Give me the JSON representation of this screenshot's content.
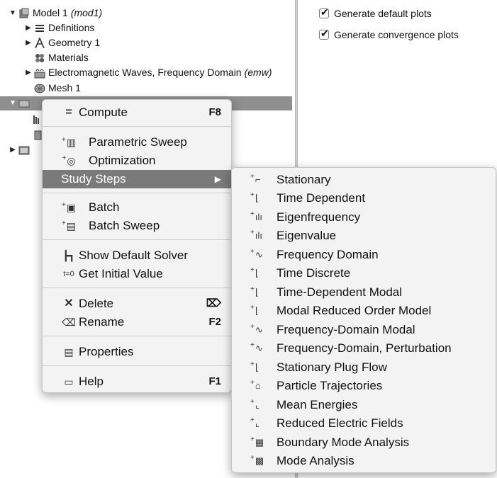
{
  "tree": {
    "rows": [
      {
        "label": "Model 1",
        "suffix": "(mod1)"
      },
      {
        "label": "Definitions",
        "suffix": ""
      },
      {
        "label": "Geometry 1",
        "suffix": ""
      },
      {
        "label": "Materials",
        "suffix": ""
      },
      {
        "label": "Electromagnetic Waves, Frequency Domain",
        "suffix": "(emw)"
      },
      {
        "label": "Mesh 1",
        "suffix": ""
      }
    ]
  },
  "settings": {
    "checkboxes": [
      {
        "label": "Generate default plots",
        "checked": true
      },
      {
        "label": "Generate convergence plots",
        "checked": true
      }
    ]
  },
  "context_menu": {
    "items": [
      {
        "label": "Compute",
        "shortcut": "F8",
        "icon": "compute-icon"
      },
      {
        "label": "Parametric Sweep",
        "shortcut": "",
        "icon": "parametric-sweep-icon"
      },
      {
        "label": "Optimization",
        "shortcut": "",
        "icon": "optimization-icon"
      },
      {
        "label": "Study Steps",
        "shortcut": "▶",
        "icon": ""
      },
      {
        "label": "Batch",
        "shortcut": "",
        "icon": "batch-icon"
      },
      {
        "label": "Batch Sweep",
        "shortcut": "",
        "icon": "batch-sweep-icon"
      },
      {
        "label": "Show Default Solver",
        "shortcut": "",
        "icon": "solver-icon"
      },
      {
        "label": "Get Initial Value",
        "shortcut": "",
        "icon": "initial-value-icon"
      },
      {
        "label": "Delete",
        "shortcut": "⌦",
        "icon": "delete-icon"
      },
      {
        "label": "Rename",
        "shortcut": "F2",
        "icon": "rename-icon"
      },
      {
        "label": "Properties",
        "shortcut": "",
        "icon": "properties-icon"
      },
      {
        "label": "Help",
        "shortcut": "F1",
        "icon": "help-icon"
      }
    ]
  },
  "submenu": {
    "items": [
      {
        "label": "Stationary",
        "icon": "stationary-icon"
      },
      {
        "label": "Time Dependent",
        "icon": "time-dependent-icon"
      },
      {
        "label": "Eigenfrequency",
        "icon": "eigenfrequency-icon"
      },
      {
        "label": "Eigenvalue",
        "icon": "eigenvalue-icon"
      },
      {
        "label": "Frequency Domain",
        "icon": "frequency-domain-icon"
      },
      {
        "label": "Time Discrete",
        "icon": "time-discrete-icon"
      },
      {
        "label": "Time-Dependent Modal",
        "icon": "time-dependent-modal-icon"
      },
      {
        "label": "Modal Reduced Order Model",
        "icon": "modal-reduced-order-icon"
      },
      {
        "label": "Frequency-Domain Modal",
        "icon": "frequency-domain-modal-icon"
      },
      {
        "label": "Frequency-Domain, Perturbation",
        "icon": "frequency-domain-perturbation-icon"
      },
      {
        "label": "Stationary Plug Flow",
        "icon": "plug-flow-icon"
      },
      {
        "label": "Particle Trajectories",
        "icon": "particle-trajectories-icon"
      },
      {
        "label": "Mean Energies",
        "icon": "mean-energies-icon"
      },
      {
        "label": "Reduced Electric Fields",
        "icon": "reduced-electric-fields-icon"
      },
      {
        "label": "Boundary Mode Analysis",
        "icon": "boundary-mode-icon"
      },
      {
        "label": "Mode Analysis",
        "icon": "mode-analysis-icon"
      }
    ]
  }
}
